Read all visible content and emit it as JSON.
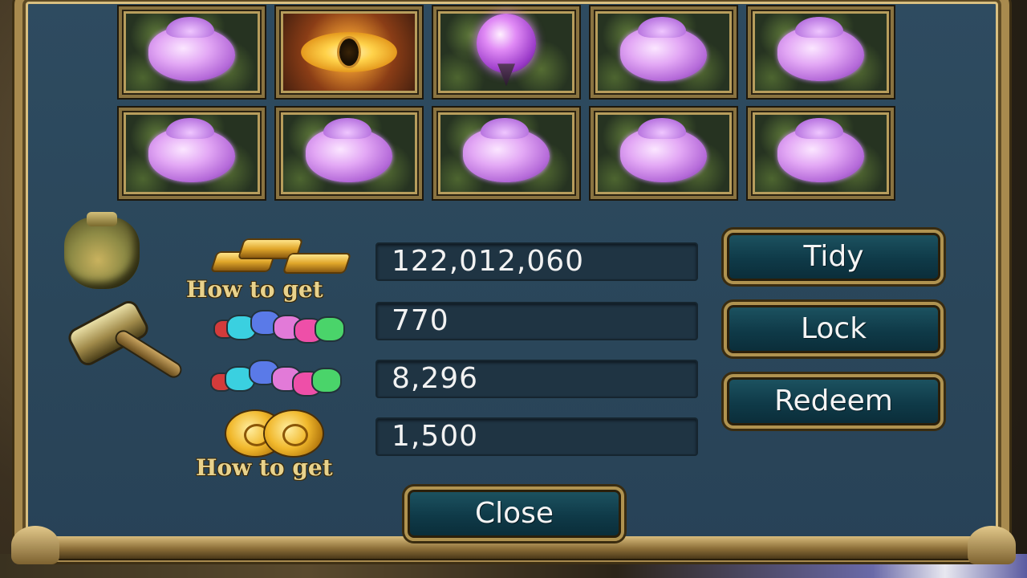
{
  "inventory": {
    "slots": [
      {
        "icon": "purple-crystal-icon"
      },
      {
        "icon": "golden-eye-icon"
      },
      {
        "icon": "purple-orb-icon"
      },
      {
        "icon": "purple-crystal-icon"
      },
      {
        "icon": "purple-crystal-icon"
      },
      {
        "icon": "purple-crystal-icon"
      },
      {
        "icon": "purple-crystal-icon"
      },
      {
        "icon": "purple-crystal-icon"
      },
      {
        "icon": "purple-crystal-icon"
      },
      {
        "icon": "purple-crystal-icon"
      }
    ]
  },
  "currencies": {
    "gold": {
      "icon": "gold-ingots-icon",
      "value": "122,012,060",
      "link": "How to get"
    },
    "gems_a": {
      "icon": "gem-pile-icon",
      "value": "770"
    },
    "gems_b": {
      "icon": "gem-pile-icon",
      "value": "8,296"
    },
    "coins": {
      "icon": "gold-coins-icon",
      "value": "1,500",
      "link": "How to get"
    }
  },
  "buttons": {
    "tidy": "Tidy",
    "lock": "Lock",
    "redeem": "Redeem",
    "close": "Close"
  },
  "colors": {
    "panel": "#2a465a",
    "frame": "#a88a4e",
    "button": "#0f3a48",
    "link_text": "#e8d28c"
  }
}
